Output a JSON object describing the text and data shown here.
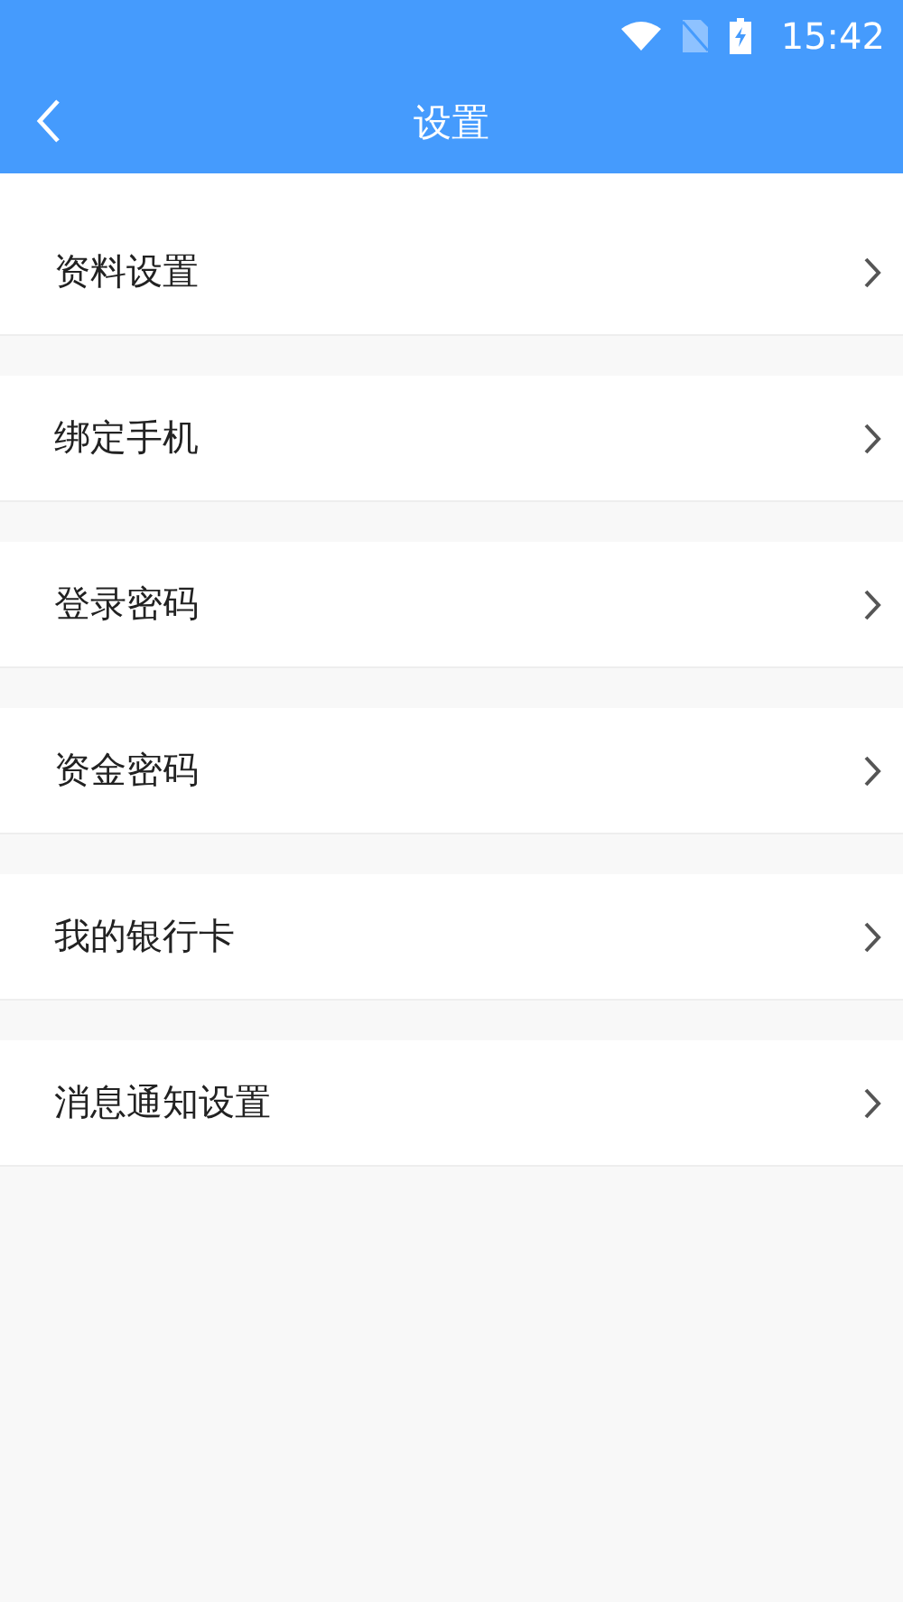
{
  "status_bar": {
    "time": "15:42"
  },
  "header": {
    "title": "设置"
  },
  "items": [
    {
      "label": "资料设置"
    },
    {
      "label": "绑定手机"
    },
    {
      "label": "登录密码"
    },
    {
      "label": "资金密码"
    },
    {
      "label": "我的银行卡"
    },
    {
      "label": "消息通知设置"
    }
  ]
}
